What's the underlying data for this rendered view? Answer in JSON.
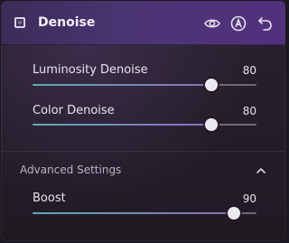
{
  "panel": {
    "title": "Denoise",
    "icons": {
      "title": "denoise-square-icon",
      "visibility": "eye-icon",
      "auto": "auto-a-icon",
      "reset": "undo-arrow-icon"
    },
    "colors": {
      "header_start": "#3b2c57",
      "header_end": "#53307e",
      "fill_start": "#5fa9b5",
      "fill_end": "#8a6fb8"
    }
  },
  "sliders": [
    {
      "label": "Luminosity Denoise",
      "value": "80",
      "fraction": 0.8
    },
    {
      "label": "Color Denoise",
      "value": "80",
      "fraction": 0.8
    }
  ],
  "advanced": {
    "title": "Advanced Settings",
    "expanded": true,
    "chevron_icon": "chevron-up-icon",
    "sliders": [
      {
        "label": "Boost",
        "value": "90",
        "fraction": 0.9
      }
    ]
  }
}
